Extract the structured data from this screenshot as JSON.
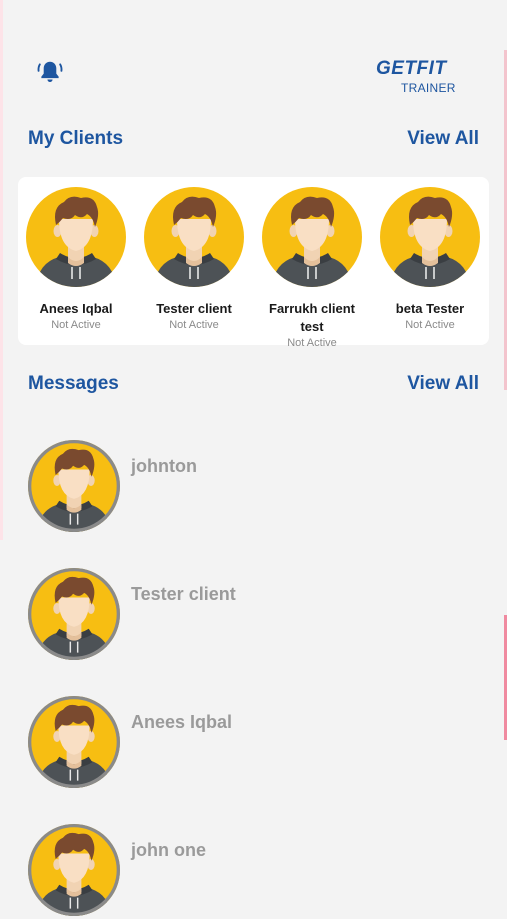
{
  "header": {
    "notification_icon": "bell-icon",
    "logo_main": "GETFIT",
    "logo_sub": "TRAINER",
    "accent_color": "#1e56a0"
  },
  "clients": {
    "title": "My Clients",
    "view_all": "View All",
    "items": [
      {
        "name": "Anees Iqbal",
        "status": "Not Active"
      },
      {
        "name": "Tester client",
        "status": "Not Active"
      },
      {
        "name": "Farrukh client test",
        "status": "Not Active"
      },
      {
        "name": "beta Tester",
        "status": "Not Active"
      }
    ]
  },
  "messages": {
    "title": "Messages",
    "view_all": "View All",
    "items": [
      {
        "name": "johnton"
      },
      {
        "name": "Tester client"
      },
      {
        "name": "Anees Iqbal"
      },
      {
        "name": "john one"
      }
    ]
  }
}
